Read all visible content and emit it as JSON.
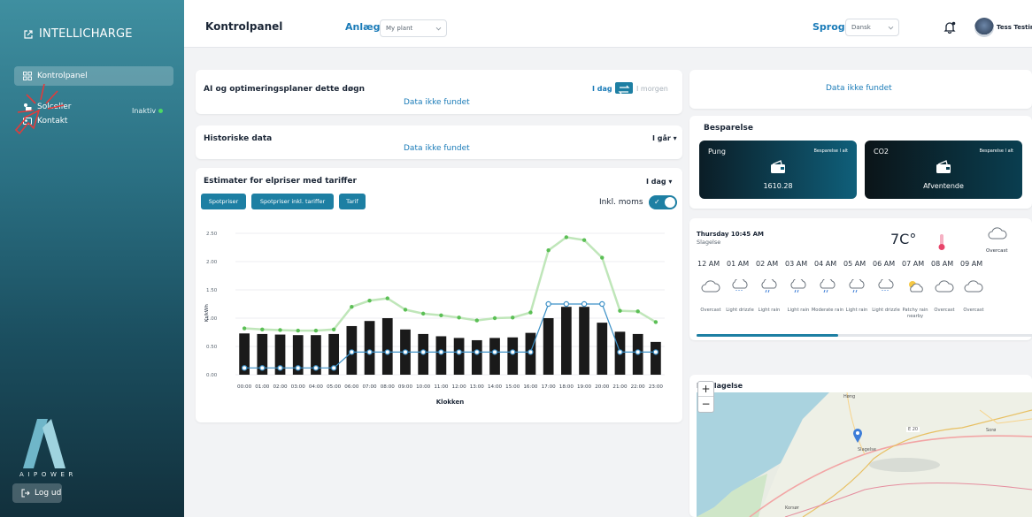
{
  "sidebar": {
    "brand": "INTELLICHARGE",
    "items": [
      {
        "label": "Kontrolpanel",
        "icon": "grid-icon"
      },
      {
        "label": "Solceller",
        "icon": "solar-icon"
      },
      {
        "label": "Kontakt",
        "icon": "contact-icon"
      }
    ],
    "status": "Inaktiv",
    "logo_text": "AIPOWER",
    "logout": "Log ud"
  },
  "topbar": {
    "title": "Kontrolpanel",
    "plant_label": "Anlæg",
    "plant_value": "My plant",
    "lang_label": "Sprog",
    "lang_value": "Dansk",
    "user": "Tess Testing"
  },
  "ai_card": {
    "title": "AI og optimeringsplaner dette døgn",
    "today": "I dag",
    "tomorrow": "I morgen",
    "nodata": "Data ikke fundet"
  },
  "history_card": {
    "title": "Historiske data",
    "period": "I går ▾",
    "nodata": "Data ikke fundet"
  },
  "price_card": {
    "title": "Estimater for elpriser med tariffer",
    "period": "I dag ▾",
    "buttons": [
      "Spotpriser",
      "Spotpriser inkl. tariffer",
      "Tarif"
    ],
    "vat": "Inkl. moms"
  },
  "chart_data": {
    "type": "bar",
    "categories": [
      "00:00",
      "01:00",
      "02:00",
      "03:00",
      "04:00",
      "05:00",
      "06:00",
      "07:00",
      "08:00",
      "09:00",
      "10:00",
      "11:00",
      "12:00",
      "13:00",
      "14:00",
      "15:00",
      "16:00",
      "17:00",
      "18:00",
      "19:00",
      "20:00",
      "21:00",
      "22:00",
      "23:00"
    ],
    "series": [
      {
        "name": "Spotpriser",
        "type": "bar",
        "color": "#1a1a1a",
        "values": [
          0.73,
          0.72,
          0.71,
          0.7,
          0.7,
          0.72,
          0.86,
          0.95,
          1.0,
          0.8,
          0.72,
          0.68,
          0.65,
          0.61,
          0.65,
          0.66,
          0.74,
          1.0,
          1.2,
          1.2,
          0.92,
          0.76,
          0.72,
          0.58
        ]
      },
      {
        "type": "line",
        "color": "#86d07d",
        "values": [
          0.82,
          0.8,
          0.79,
          0.78,
          0.78,
          0.8,
          1.2,
          1.31,
          1.35,
          1.15,
          1.08,
          1.05,
          1.01,
          0.96,
          1.0,
          1.01,
          1.1,
          2.2,
          2.43,
          2.38,
          2.07,
          1.13,
          1.12,
          0.93
        ]
      },
      {
        "type": "line",
        "color": "#3a8fc6",
        "values": [
          0.12,
          0.12,
          0.12,
          0.12,
          0.12,
          0.12,
          0.4,
          0.4,
          0.4,
          0.4,
          0.4,
          0.4,
          0.4,
          0.4,
          0.4,
          0.4,
          0.4,
          1.25,
          1.25,
          1.25,
          1.25,
          0.4,
          0.4,
          0.4
        ]
      }
    ],
    "xlabel": "Klokken",
    "ylabel": "Kr/kWh",
    "ylim": [
      0,
      2.5
    ],
    "yticks": [
      "0.00",
      "0.50",
      "1.00",
      "1.50",
      "2.00",
      "2.50"
    ],
    "grid": true
  },
  "right_top": {
    "nodata": "Data ikke fundet"
  },
  "savings": {
    "title": "Besparelse",
    "cards": [
      {
        "name": "Pung",
        "sub": "Besparelse I alt",
        "value": "1610.28",
        "color": "#0f5f7a"
      },
      {
        "name": "CO2",
        "sub": "Besparelse I alt",
        "value": "Afventende",
        "color": "#0a3e50"
      }
    ]
  },
  "weather": {
    "datetime": "Thursday 10:45 AM",
    "city": "Slagelse",
    "temp": "7C°",
    "condition": "Overcast",
    "hours": [
      {
        "time": "12 AM",
        "desc": "Overcast",
        "icon": "cloud-icon"
      },
      {
        "time": "01 AM",
        "desc": "Light drizzle",
        "icon": "drizzle-icon"
      },
      {
        "time": "02 AM",
        "desc": "Light rain",
        "icon": "rain-icon"
      },
      {
        "time": "03 AM",
        "desc": "Light rain",
        "icon": "rain-icon"
      },
      {
        "time": "04 AM",
        "desc": "Moderate rain",
        "icon": "rain-icon"
      },
      {
        "time": "05 AM",
        "desc": "Light rain",
        "icon": "rain-icon"
      },
      {
        "time": "06 AM",
        "desc": "Light drizzle",
        "icon": "drizzle-icon"
      },
      {
        "time": "07 AM",
        "desc": "Patchy rain nearby",
        "icon": "sun-cloud-icon"
      },
      {
        "time": "08 AM",
        "desc": "Overcast",
        "icon": "cloud-icon"
      },
      {
        "time": "09 AM",
        "desc": "Overcast",
        "icon": "cloud-icon"
      }
    ]
  },
  "map": {
    "title": "By Slagelse",
    "labels": [
      "Høng",
      "E 20",
      "Sorø",
      "Slagelse",
      "Korsør"
    ]
  }
}
